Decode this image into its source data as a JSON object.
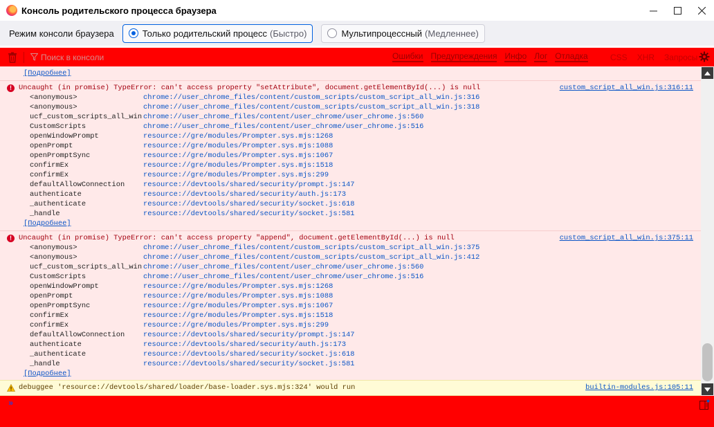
{
  "window": {
    "title": "Консоль родительского процесса браузера",
    "controls": {
      "minimize": "—",
      "maximize": "□",
      "close": "✕"
    }
  },
  "mode_bar": {
    "label": "Режим консоли браузера",
    "options": [
      {
        "label": "Только родительский процесс",
        "hint": "(Быстро)",
        "selected": true
      },
      {
        "label": "Мультипроцессный",
        "hint": "(Медленнее)",
        "selected": false
      }
    ]
  },
  "toolbar": {
    "filter_placeholder": "Поиск в консоли",
    "levels": [
      "Ошибки",
      "Предупреждения",
      "Инфо",
      "Лог",
      "Отладка"
    ],
    "types": [
      "CSS",
      "XHR",
      "Запросы"
    ],
    "icons": {
      "clear": "trash-icon",
      "filter": "funnel-icon",
      "settings": "gear-icon"
    },
    "colors": {
      "background": "#ff0000"
    }
  },
  "output": {
    "top_more": "[Подробнее]",
    "messages": [
      {
        "level": "error",
        "text": "Uncaught (in promise) TypeError: can't access property \"setAttribute\", document.getElementById(...) is null",
        "source": "custom_script_all_win.js:316:11",
        "frames": [
          {
            "fn": "<anonymous>",
            "loc": "chrome://user_chrome_files/content/custom_scripts/custom_script_all_win.js:316"
          },
          {
            "fn": "<anonymous>",
            "loc": "chrome://user_chrome_files/content/custom_scripts/custom_script_all_win.js:318"
          },
          {
            "fn": "ucf_custom_scripts_all_win",
            "loc": "chrome://user_chrome_files/content/user_chrome/user_chrome.js:560"
          },
          {
            "fn": "CustomScripts",
            "loc": "chrome://user_chrome_files/content/user_chrome/user_chrome.js:516"
          },
          {
            "fn": "openWindowPrompt",
            "loc": "resource://gre/modules/Prompter.sys.mjs:1268"
          },
          {
            "fn": "openPrompt",
            "loc": "resource://gre/modules/Prompter.sys.mjs:1088"
          },
          {
            "fn": "openPromptSync",
            "loc": "resource://gre/modules/Prompter.sys.mjs:1067"
          },
          {
            "fn": "confirmEx",
            "loc": "resource://gre/modules/Prompter.sys.mjs:1518"
          },
          {
            "fn": "confirmEx",
            "loc": "resource://gre/modules/Prompter.sys.mjs:299"
          },
          {
            "fn": "defaultAllowConnection",
            "loc": "resource://devtools/shared/security/prompt.js:147"
          },
          {
            "fn": "authenticate",
            "loc": "resource://devtools/shared/security/auth.js:173"
          },
          {
            "fn": "_authenticate",
            "loc": "resource://devtools/shared/security/socket.js:618"
          },
          {
            "fn": "_handle",
            "loc": "resource://devtools/shared/security/socket.js:581"
          }
        ],
        "more": "[Подробнее]"
      },
      {
        "level": "error",
        "text": "Uncaught (in promise) TypeError: can't access property \"append\", document.getElementById(...) is null",
        "source": "custom_script_all_win.js:375:11",
        "frames": [
          {
            "fn": "<anonymous>",
            "loc": "chrome://user_chrome_files/content/custom_scripts/custom_script_all_win.js:375"
          },
          {
            "fn": "<anonymous>",
            "loc": "chrome://user_chrome_files/content/custom_scripts/custom_script_all_win.js:412"
          },
          {
            "fn": "ucf_custom_scripts_all_win",
            "loc": "chrome://user_chrome_files/content/user_chrome/user_chrome.js:560"
          },
          {
            "fn": "CustomScripts",
            "loc": "chrome://user_chrome_files/content/user_chrome/user_chrome.js:516"
          },
          {
            "fn": "openWindowPrompt",
            "loc": "resource://gre/modules/Prompter.sys.mjs:1268"
          },
          {
            "fn": "openPrompt",
            "loc": "resource://gre/modules/Prompter.sys.mjs:1088"
          },
          {
            "fn": "openPromptSync",
            "loc": "resource://gre/modules/Prompter.sys.mjs:1067"
          },
          {
            "fn": "confirmEx",
            "loc": "resource://gre/modules/Prompter.sys.mjs:1518"
          },
          {
            "fn": "confirmEx",
            "loc": "resource://gre/modules/Prompter.sys.mjs:299"
          },
          {
            "fn": "defaultAllowConnection",
            "loc": "resource://devtools/shared/security/prompt.js:147"
          },
          {
            "fn": "authenticate",
            "loc": "resource://devtools/shared/security/auth.js:173"
          },
          {
            "fn": "_authenticate",
            "loc": "resource://devtools/shared/security/socket.js:618"
          },
          {
            "fn": "_handle",
            "loc": "resource://devtools/shared/security/socket.js:581"
          }
        ],
        "more": "[Подробнее]"
      }
    ],
    "warning": {
      "text": "debuggee 'resource://devtools/shared/loader/base-loader.sys.mjs:324' would run",
      "source": "builtin-modules.js:105:11"
    }
  },
  "input": {
    "prompt": "»"
  }
}
